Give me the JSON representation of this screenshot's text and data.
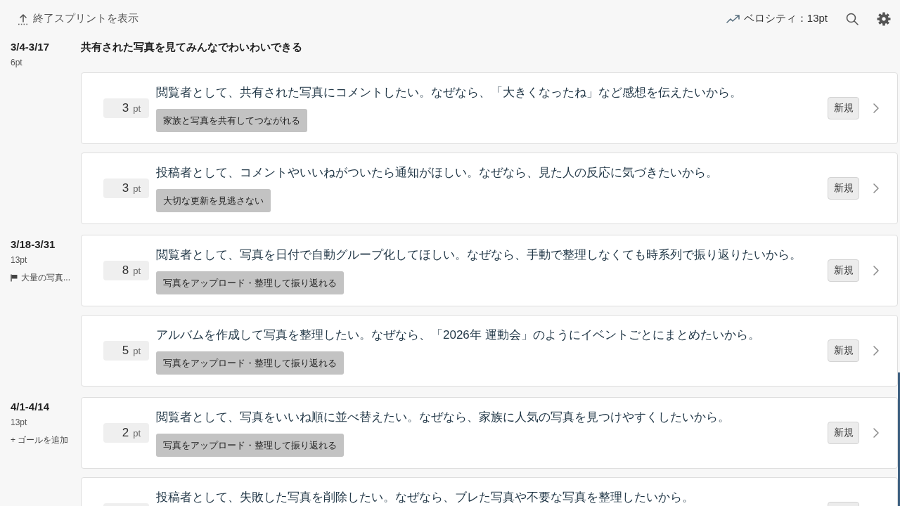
{
  "toolbar": {
    "show_finished_sprints": "終了スプリントを表示",
    "velocity": "ベロシティ：13pt"
  },
  "sprints": [
    {
      "dates": "3/4-3/17",
      "points": "6pt",
      "goal": {
        "kind": "header",
        "text": "共有された写真を見てみんなでわいわいできる"
      },
      "stories": [
        {
          "points": "3",
          "unit": "pt",
          "title": "閲覧者として、共有された写真にコメントしたい。なぜなら、「大きくなったね」など感想を伝えたいから。",
          "tag": "家族と写真を共有してつながれる",
          "status": "新規"
        },
        {
          "points": "3",
          "unit": "pt",
          "title": "投稿者として、コメントやいいねがついたら通知がほしい。なぜなら、見た人の反応に気づきたいから。",
          "tag": "大切な更新を見逃さない",
          "status": "新規"
        }
      ]
    },
    {
      "dates": "3/18-3/31",
      "points": "13pt",
      "goal": {
        "kind": "flag",
        "text": "大量の写真..."
      },
      "stories": [
        {
          "points": "8",
          "unit": "pt",
          "title": "閲覧者として、写真を日付で自動グループ化してほしい。なぜなら、手動で整理しなくても時系列で振り返りたいから。",
          "tag": "写真をアップロード・整理して振り返れる",
          "status": "新規"
        },
        {
          "points": "5",
          "unit": "pt",
          "title": "アルバムを作成して写真を整理したい。なぜなら、「2026年 運動会」のようにイベントごとにまとめたいから。",
          "tag": "写真をアップロード・整理して振り返れる",
          "status": "新規"
        }
      ]
    },
    {
      "dates": "4/1-4/14",
      "points": "13pt",
      "goal": {
        "kind": "add",
        "text": "+ ゴールを追加"
      },
      "stories": [
        {
          "points": "2",
          "unit": "pt",
          "title": "閲覧者として、写真をいいね順に並べ替えたい。なぜなら、家族に人気の写真を見つけやすくしたいから。",
          "tag": "写真をアップロード・整理して振り返れる",
          "status": "新規"
        },
        {
          "title": "投稿者として、失敗した写真を削除したい。なぜなら、ブレた写真や不要な写真を整理したいから。"
        }
      ]
    }
  ]
}
